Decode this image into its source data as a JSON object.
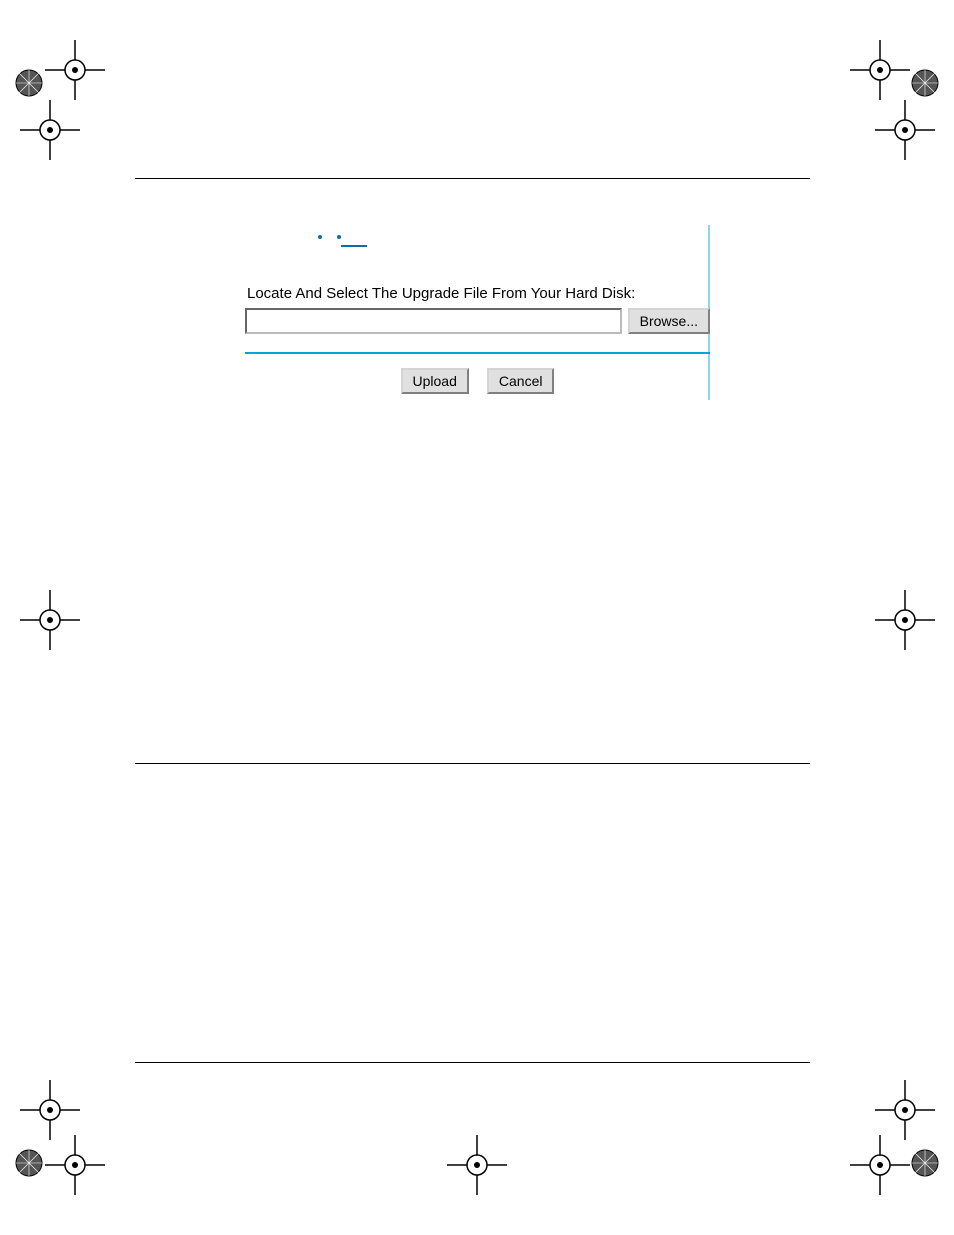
{
  "dialog": {
    "instruction": "Locate And Select The Upgrade File From Your Hard Disk:",
    "file_value": "",
    "browse_label": "Browse...",
    "upload_label": "Upload",
    "cancel_label": "Cancel"
  }
}
